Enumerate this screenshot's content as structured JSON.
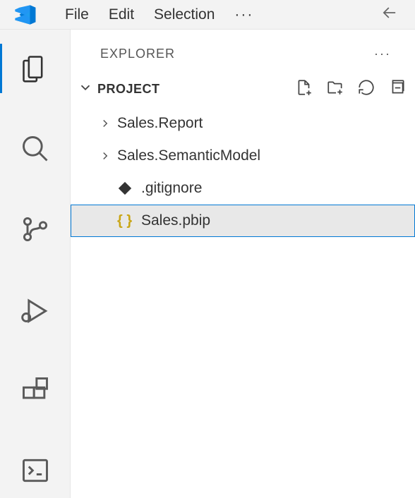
{
  "titlebar": {
    "menu": [
      "File",
      "Edit",
      "Selection"
    ],
    "ellipsis": "···"
  },
  "sidebar": {
    "title": "EXPLORER",
    "ellipsis": "···"
  },
  "project": {
    "title": "PROJECT",
    "items": [
      {
        "label": "Sales.Report",
        "kind": "folder"
      },
      {
        "label": "Sales.SemanticModel",
        "kind": "folder"
      },
      {
        "label": ".gitignore",
        "kind": "gitignore"
      },
      {
        "label": "Sales.pbip",
        "kind": "json",
        "selected": true
      }
    ]
  }
}
